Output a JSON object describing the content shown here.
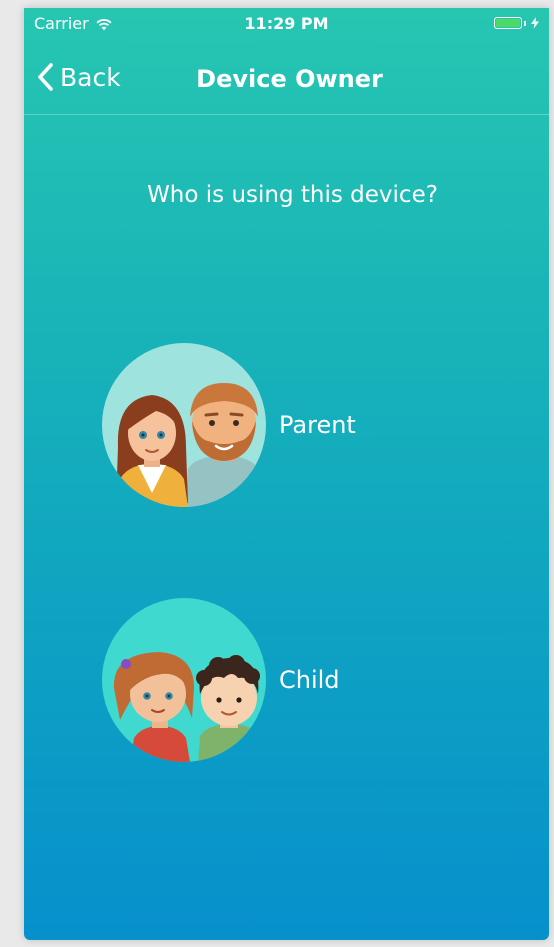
{
  "status_bar": {
    "carrier": "Carrier",
    "time": "11:29 PM",
    "battery_level": 1.0,
    "battery_color": "#4cd964",
    "charging": true
  },
  "nav": {
    "back_label": "Back",
    "title": "Device Owner"
  },
  "prompt": "Who is using this device?",
  "options": [
    {
      "label": "Parent",
      "icon": "parents-avatar-icon"
    },
    {
      "label": "Child",
      "icon": "children-avatar-icon"
    }
  ],
  "colors": {
    "gradient_top": "#27c6b1",
    "gradient_bottom": "#0790cc",
    "parent_avatar_bg": "#9fe3de",
    "child_avatar_bg": "#3fd9d0"
  }
}
